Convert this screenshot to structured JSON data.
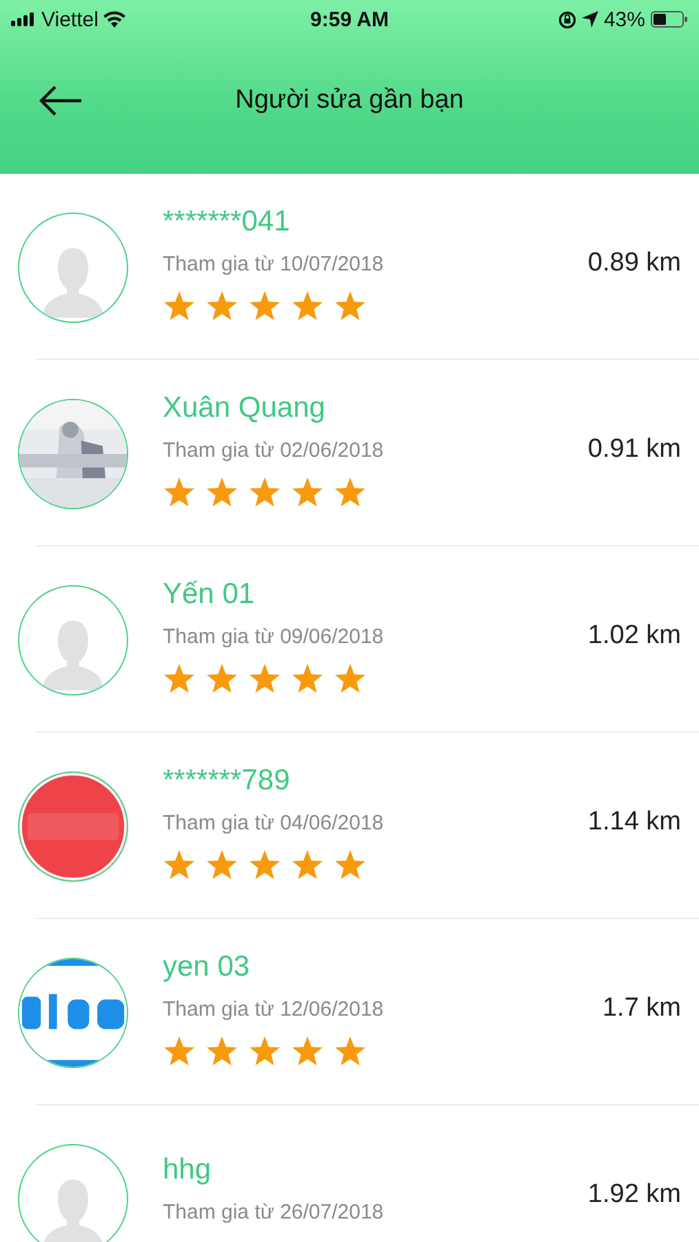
{
  "status_bar": {
    "carrier": "Viettel",
    "time": "9:59 AM",
    "battery": "43%"
  },
  "header": {
    "title": "Người sửa gần bạn"
  },
  "repairers": [
    {
      "name": "*******041",
      "joined": "Tham gia từ 10/07/2018",
      "distance": "0.89 km",
      "stars": 5,
      "avatar": {
        "kind": "placeholder"
      }
    },
    {
      "name": "Xuân Quang",
      "joined": "Tham gia từ 02/06/2018",
      "distance": "0.91 km",
      "stars": 5
    },
    {
      "name": "Yến 01",
      "joined": "Tham gia từ 09/06/2018",
      "distance": "1.02 km",
      "stars": 5,
      "avatar": {
        "kind": "placeholder"
      }
    },
    {
      "name": "*******789",
      "joined": "Tham gia từ 04/06/2018",
      "distance": "1.14 km",
      "stars": 5
    },
    {
      "name": "yen 03",
      "joined": "Tham gia từ 12/06/2018",
      "distance": "1.7 km",
      "stars": 5
    },
    {
      "name": "hhg",
      "joined": "Tham gia từ 26/07/2018",
      "distance": "1.92 km",
      "avatar": {
        "kind": "placeholder"
      }
    }
  ]
}
